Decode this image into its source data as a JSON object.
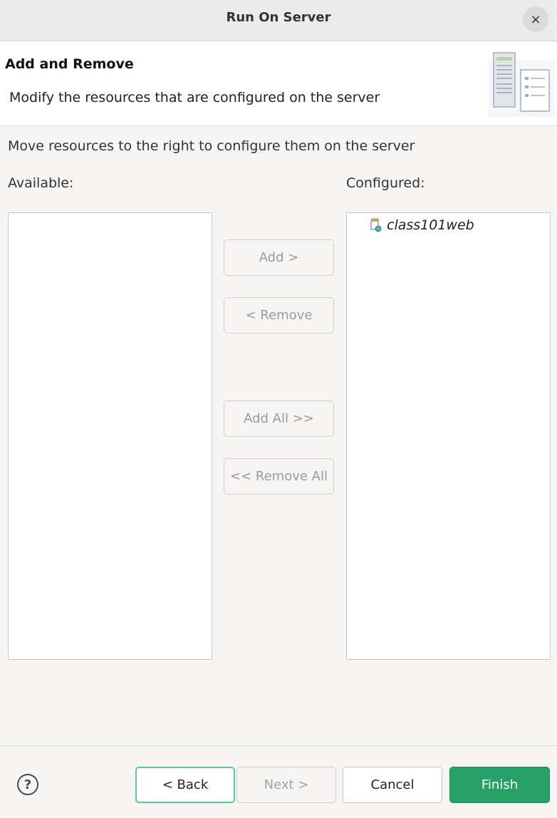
{
  "window": {
    "title": "Run On Server",
    "close_symbol": "×"
  },
  "header": {
    "title": "Add and Remove",
    "description": "Modify the resources that are configured on the server",
    "icon": "server-wizard-icon"
  },
  "instruction": "Move resources to the right to configure them on the server",
  "available": {
    "label": "Available:",
    "items": []
  },
  "configured": {
    "label": "Configured:",
    "items": [
      {
        "label": "class101web",
        "icon": "web-project-icon"
      }
    ]
  },
  "actions": {
    "add": "Add >",
    "remove": "< Remove",
    "add_all": "Add All >>",
    "remove_all": "<< Remove All"
  },
  "footer": {
    "help_symbol": "?",
    "back": "< Back",
    "next": "Next >",
    "cancel": "Cancel",
    "finish": "Finish"
  },
  "colors": {
    "accent": "#26a269",
    "focus": "#5fc4a5",
    "background": "#f6f5f4"
  }
}
